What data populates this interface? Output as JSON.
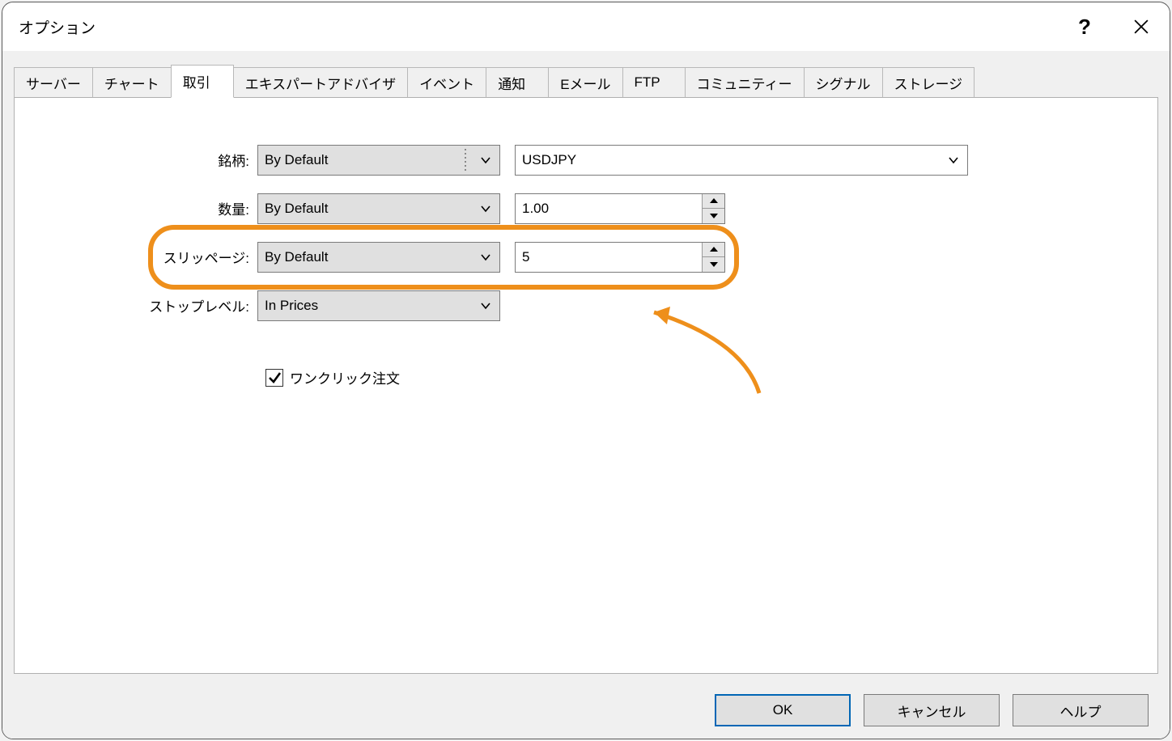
{
  "window": {
    "title": "オプション",
    "help": "?"
  },
  "tabs": [
    {
      "id": "server",
      "label": "サーバー"
    },
    {
      "id": "chart",
      "label": "チャート"
    },
    {
      "id": "trade",
      "label": "取引",
      "active": true
    },
    {
      "id": "ea",
      "label": "エキスパートアドバイザ"
    },
    {
      "id": "event",
      "label": "イベント"
    },
    {
      "id": "notify",
      "label": "通知"
    },
    {
      "id": "email",
      "label": "Eメール"
    },
    {
      "id": "ftp",
      "label": "FTP"
    },
    {
      "id": "community",
      "label": "コミュニティー"
    },
    {
      "id": "signal",
      "label": "シグナル"
    },
    {
      "id": "storage",
      "label": "ストレージ"
    }
  ],
  "form": {
    "symbol": {
      "label": "銘柄:",
      "mode": "By Default",
      "value": "USDJPY"
    },
    "volume": {
      "label": "数量:",
      "mode": "By Default",
      "value": "1.00"
    },
    "slippage": {
      "label": "スリッページ:",
      "mode": "By Default",
      "value": "5"
    },
    "stoplevel": {
      "label": "ストップレベル:",
      "mode": "In Prices"
    },
    "one_click": {
      "label": "ワンクリック注文",
      "checked": true
    }
  },
  "buttons": {
    "ok": "OK",
    "cancel": "キャンセル",
    "help": "ヘルプ"
  },
  "annotation": {
    "color": "#ee8f1b"
  }
}
